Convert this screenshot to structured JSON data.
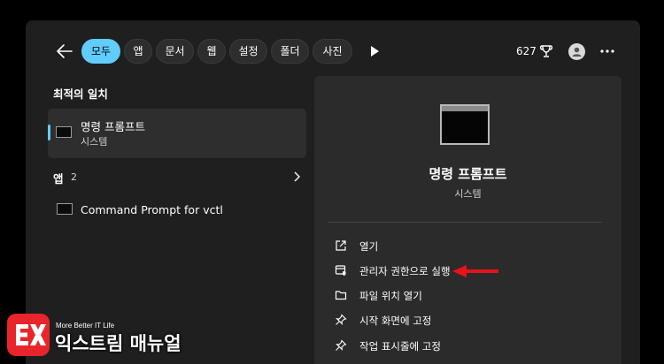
{
  "filters": {
    "items": [
      {
        "label": "모두",
        "active": true
      },
      {
        "label": "앱",
        "active": false
      },
      {
        "label": "문서",
        "active": false
      },
      {
        "label": "웹",
        "active": false
      },
      {
        "label": "설정",
        "active": false
      },
      {
        "label": "폴더",
        "active": false
      },
      {
        "label": "사진",
        "active": false
      }
    ]
  },
  "header": {
    "points": "627"
  },
  "best_match": {
    "section_title": "최적의 일치",
    "name": "명령 프롬프트",
    "type": "시스템"
  },
  "apps": {
    "section_title": "앱",
    "count": "2",
    "items": [
      {
        "label": "Command Prompt for vctl"
      }
    ]
  },
  "preview": {
    "name": "명령 프롬프트",
    "type": "시스템",
    "actions": [
      {
        "label": "열기",
        "icon": "open-external-icon"
      },
      {
        "label": "관리자 권한으로 실행",
        "icon": "run-as-admin-icon"
      },
      {
        "label": "파일 위치 열기",
        "icon": "folder-icon"
      },
      {
        "label": "시작 화면에 고정",
        "icon": "pin-icon"
      },
      {
        "label": "작업 표시줄에 고정",
        "icon": "pin-icon"
      }
    ]
  },
  "watermark": {
    "tagline": "More Better IT Life",
    "name": "익스트림 매뉴얼"
  },
  "colors": {
    "accent": "#60cdff",
    "arrow": "#e8121b",
    "logo": "#e8252b"
  }
}
